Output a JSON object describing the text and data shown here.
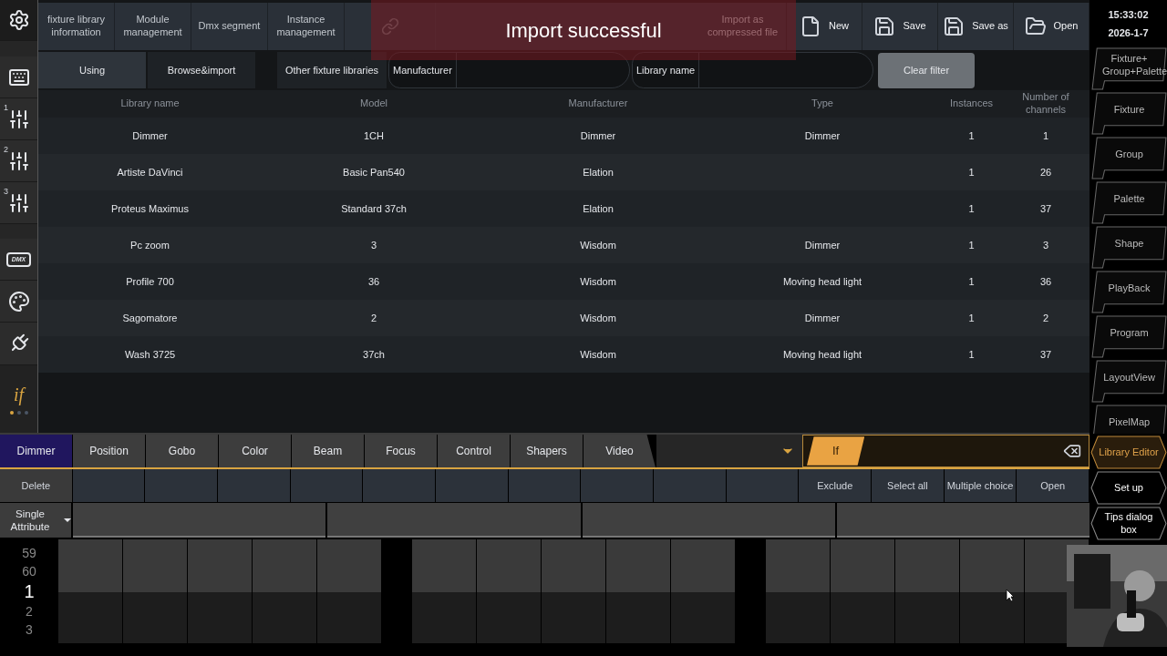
{
  "sidebar": {
    "items": [
      {
        "kind": "gear",
        "selected": false
      },
      {
        "kind": "keyboard",
        "selected": false
      },
      {
        "kind": "sliders",
        "number": "1",
        "selected": false
      },
      {
        "kind": "sliders",
        "number": "2",
        "selected": false
      },
      {
        "kind": "sliders",
        "number": "3",
        "selected": false
      },
      {
        "kind": "dmx",
        "label": "DMX",
        "selected": false
      },
      {
        "kind": "palette",
        "selected": false
      },
      {
        "kind": "plug",
        "selected": false
      }
    ],
    "logo": "if",
    "pages": [
      {
        "selected": true
      },
      {
        "selected": false
      },
      {
        "selected": false
      }
    ]
  },
  "toolbar": [
    {
      "label": "fixture library information",
      "disabled": true
    },
    {
      "label": "Module management",
      "disabled": true
    },
    {
      "label": "Dmx segment",
      "disabled": true
    },
    {
      "label": "Instance management",
      "disabled": true
    },
    {
      "kind": "link",
      "disabled": true
    },
    {
      "label": "Import as compressed file",
      "disabled": true
    },
    {
      "label": "New",
      "kind": "file",
      "disabled": false
    },
    {
      "label": "Save",
      "kind": "save",
      "disabled": false
    },
    {
      "label": "Save as",
      "kind": "save-as",
      "disabled": false
    },
    {
      "label": "Open",
      "kind": "folder",
      "disabled": false
    }
  ],
  "toast": "Import successful",
  "view_tabs": [
    {
      "label": "Using",
      "selected": true
    },
    {
      "label": "Browse&import",
      "selected": false
    }
  ],
  "other_libraries": "Other fixture libraries",
  "filters": [
    {
      "label": "Manufacturer"
    },
    {
      "label": "Library name"
    }
  ],
  "clear_filter": "Clear filter",
  "table": {
    "columns": [
      "Library name",
      "Model",
      "Manufacturer",
      "Type",
      "Instances",
      "Number of channels"
    ],
    "rows": [
      [
        "Dimmer",
        "1CH",
        "Dimmer",
        "Dimmer",
        "1",
        "1"
      ],
      [
        "Artiste DaVinci",
        "Basic Pan540",
        "Elation",
        "",
        "1",
        "26"
      ],
      [
        "Proteus Maximus",
        "Standard 37ch",
        "Elation",
        "",
        "1",
        "37"
      ],
      [
        "Pc zoom",
        "3",
        "Wisdom",
        "Dimmer",
        "1",
        "3"
      ],
      [
        "Profile 700",
        "36",
        "Wisdom",
        "Moving head light",
        "1",
        "36"
      ],
      [
        "Sagomatore",
        "2",
        "Wisdom",
        "Dimmer",
        "1",
        "2"
      ],
      [
        "Wash 3725",
        "37ch",
        "Wisdom",
        "Moving head light",
        "1",
        "37"
      ]
    ]
  },
  "clock": {
    "time": "15:33:02",
    "date": "2026-1-7"
  },
  "nav": [
    {
      "label": "Fixture+ Group+Palette"
    },
    {
      "label": "Fixture"
    },
    {
      "label": "Group"
    },
    {
      "label": "Palette"
    },
    {
      "label": "Shape"
    },
    {
      "label": "PlayBack"
    },
    {
      "label": "Program"
    },
    {
      "label": "LayoutView"
    },
    {
      "label": "PixelMap"
    }
  ],
  "attribute_tabs": [
    {
      "label": "Dimmer",
      "selected": true
    },
    {
      "label": "Position",
      "selected": false
    },
    {
      "label": "Gobo",
      "selected": false
    },
    {
      "label": "Color",
      "selected": false
    },
    {
      "label": "Beam",
      "selected": false
    },
    {
      "label": "Focus",
      "selected": false
    },
    {
      "label": "Control",
      "selected": false
    },
    {
      "label": "Shapers",
      "selected": false
    },
    {
      "label": "Video",
      "selected": false
    }
  ],
  "filter_chip": "If",
  "side_buttons": [
    {
      "label": "Library Editor",
      "selected": true
    },
    {
      "label": "Set up",
      "selected": false
    },
    {
      "label": "Tips dialog box",
      "selected": false
    }
  ],
  "function_keys": [
    {
      "label": "Delete"
    },
    {
      "label": "Exclude"
    },
    {
      "label": "Select all"
    },
    {
      "label": "Multiple choice"
    },
    {
      "label": "Open"
    }
  ],
  "mode_select": "Single Attribute",
  "wheel": [
    {
      "value": "59",
      "selected": false
    },
    {
      "value": "60",
      "selected": false
    },
    {
      "value": "1",
      "selected": true
    },
    {
      "value": "2",
      "selected": false
    },
    {
      "value": "3",
      "selected": false
    }
  ]
}
